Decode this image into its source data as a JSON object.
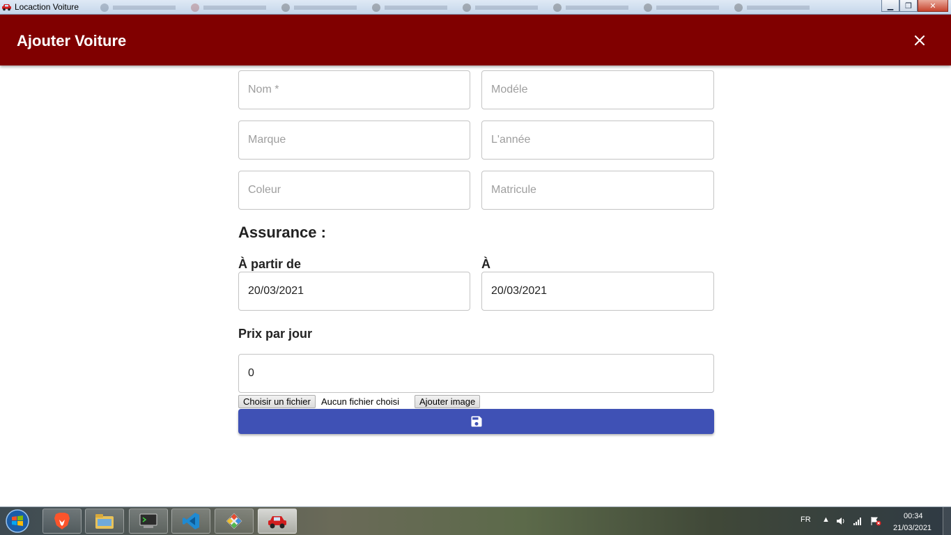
{
  "window": {
    "title": "Locaction Voiture",
    "minimize_glyph": "▁",
    "maximize_glyph": "❐",
    "close_glyph": "✕"
  },
  "header": {
    "title": "Ajouter Voiture",
    "close_icon": "close-icon",
    "background_color": "#800000"
  },
  "form": {
    "fields": {
      "nom": {
        "placeholder": "Nom *",
        "value": ""
      },
      "modele": {
        "placeholder": "Modéle",
        "value": ""
      },
      "marque": {
        "placeholder": "Marque",
        "value": ""
      },
      "annee": {
        "placeholder": "L'année",
        "value": ""
      },
      "coleur": {
        "placeholder": "Coleur",
        "value": ""
      },
      "matricule": {
        "placeholder": "Matricule",
        "value": ""
      }
    },
    "assurance": {
      "title": "Assurance :",
      "from_label": "À partir de",
      "from_value": "20/03/2021",
      "to_label": "À",
      "to_value": "20/03/2021"
    },
    "price": {
      "label": "Prix par jour",
      "value": "0"
    },
    "file": {
      "choose_label": "Choisir un fichier",
      "status": "Aucun fichier choisi",
      "add_image_label": "Ajouter image"
    },
    "save_button": {
      "icon": "save-icon",
      "color": "#3f51b5"
    }
  },
  "taskbar": {
    "items": [
      "brave-browser-icon",
      "file-explorer-icon",
      "terminal-icon",
      "vscode-icon",
      "git-icon",
      "car-app-icon"
    ],
    "language": "FR",
    "time": "00:34",
    "date": "21/03/2021"
  }
}
